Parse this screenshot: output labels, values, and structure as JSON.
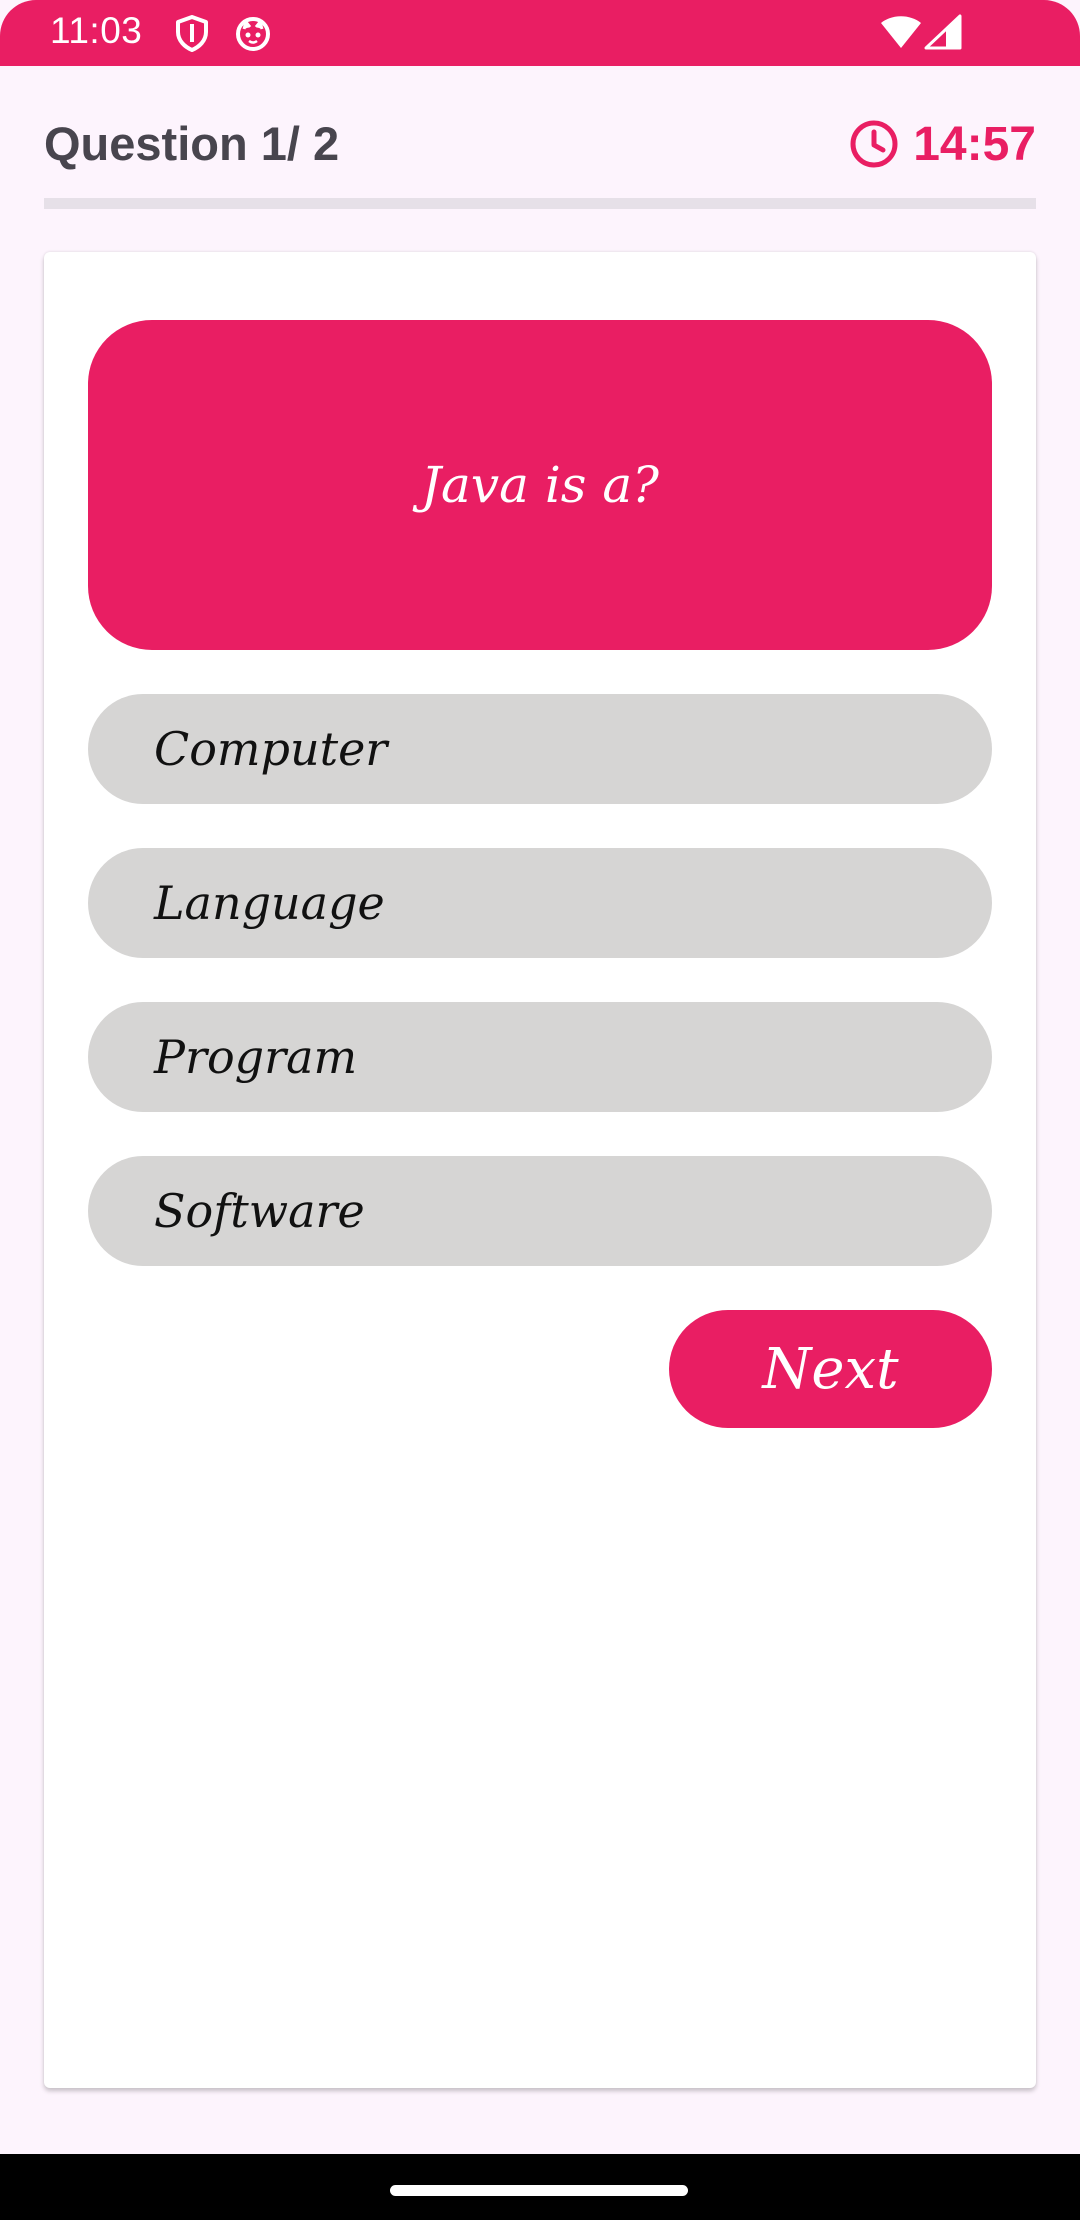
{
  "status_bar": {
    "time": "11:03",
    "icons": [
      "shield-icon",
      "cat-icon",
      "wifi-icon",
      "cell-signal-icon"
    ],
    "color": "#e91e63"
  },
  "header": {
    "title": "Question 1/ 2",
    "timer_icon": "clock-icon",
    "timer": "14:57",
    "progress_fraction": 0
  },
  "quiz": {
    "question": "Java is a?",
    "options": [
      {
        "label": "Computer"
      },
      {
        "label": "Language"
      },
      {
        "label": "Program"
      },
      {
        "label": "Software"
      }
    ],
    "next_label": "Next"
  },
  "colors": {
    "accent": "#e91e63",
    "option_bg": "#d6d5d4",
    "page_bg": "#fdf4fd",
    "title_text": "#48454e"
  }
}
